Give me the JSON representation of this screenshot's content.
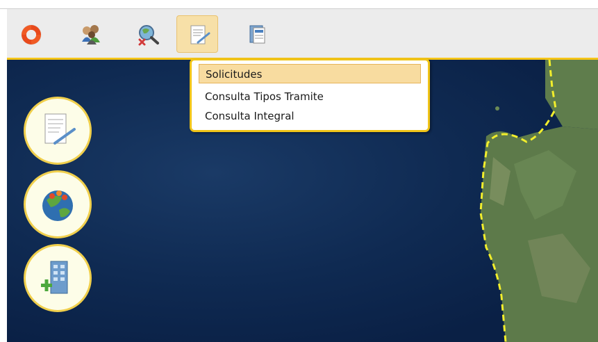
{
  "toolbar": {
    "buttons": [
      {
        "icon": "lifebuoy-icon",
        "active": false
      },
      {
        "icon": "users-icon",
        "active": false
      },
      {
        "icon": "search-globe-icon",
        "active": false
      },
      {
        "icon": "edit-document-icon",
        "active": true
      },
      {
        "icon": "folder-icon",
        "active": false
      }
    ],
    "accent_color": "#f5c518"
  },
  "menu": {
    "items": [
      {
        "label": "Solicitudes",
        "selected": true
      },
      {
        "label": "Consulta Tipos Tramite",
        "selected": false
      },
      {
        "label": "Consulta Integral",
        "selected": false
      }
    ]
  },
  "side_buttons": [
    {
      "icon": "document-edit-icon"
    },
    {
      "icon": "earth-pins-icon"
    },
    {
      "icon": "building-add-icon"
    }
  ],
  "map": {
    "coastline_color": "#f2ee2c",
    "sea_color": "#0f2a52",
    "land_color": "#5d7a4a"
  }
}
